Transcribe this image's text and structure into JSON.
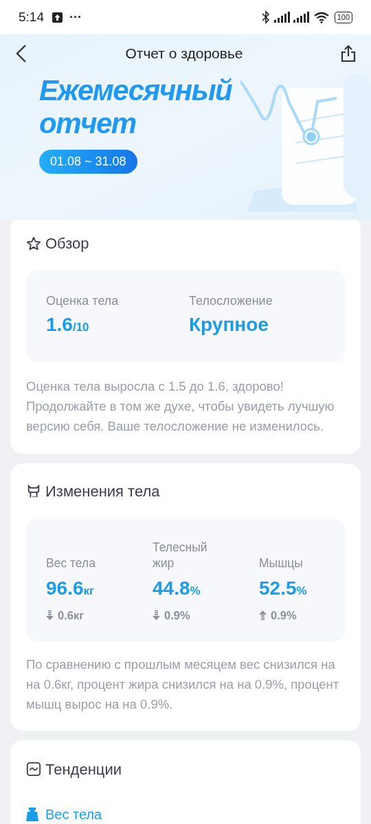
{
  "status_bar": {
    "time": "5:14",
    "ellipsis": "···",
    "battery": "100"
  },
  "header": {
    "title": "Отчет о здоровье"
  },
  "banner": {
    "title_line1": "Ежемесячный",
    "title_line2": "отчет",
    "period": "01.08 ~ 31.08"
  },
  "overview": {
    "title": "Обзор",
    "metrics": [
      {
        "label": "Оценка тела",
        "value": "1.6",
        "unit": "/10"
      },
      {
        "label": "Телосложение",
        "value": "Крупное"
      }
    ],
    "summary": "Оценка тела выросла с 1.5 до 1.6, здорово! Продолжайте в том же духе, чтобы увидеть лучшую версию себя. Ваше телосложение не изменилось."
  },
  "body_changes": {
    "title": "Изменения тела",
    "metrics": [
      {
        "label": "Вес тела",
        "value": "96.6",
        "unit": "кг",
        "kind": "decrease",
        "change": "0.6кг"
      },
      {
        "label": "Телесный жир",
        "value": "44.8",
        "unit": "%",
        "kind": "decrease",
        "change": "0.9%"
      },
      {
        "label": "Мышцы",
        "value": "52.5",
        "unit": "%",
        "kind": "increase",
        "change": "0.9%"
      }
    ],
    "summary": "По сравнению с прошлым месяцем вес снизился на на 0.6кг, процент жира снизился на на 0.9%, процент мышц вырос на на 0.9%."
  },
  "trends": {
    "title": "Тенденции",
    "legend": "Вес тела"
  }
}
